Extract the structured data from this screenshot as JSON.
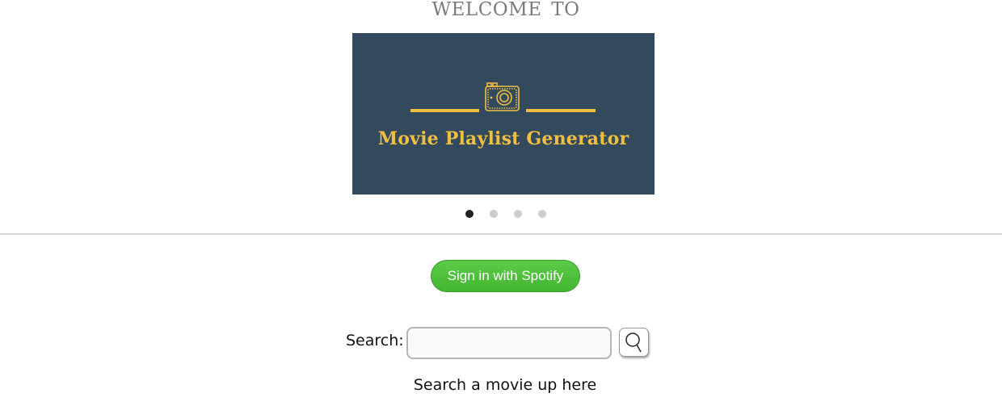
{
  "header": {
    "welcome_text": "WELCOME  TO"
  },
  "carousel": {
    "banner_title": "Movie Playlist Generator",
    "banner_icon": "camera-icon",
    "slide_count": 4,
    "active_slide": 1,
    "colors": {
      "banner_bg": "#334a5e",
      "banner_accent": "#f1bf3f"
    }
  },
  "auth": {
    "spotify_label": "Sign in with Spotify",
    "spotify_color": "#4bbd38"
  },
  "search": {
    "label": "Search:",
    "value": "",
    "placeholder": "",
    "button_icon": "search-icon",
    "hint": "Search a movie up here"
  }
}
